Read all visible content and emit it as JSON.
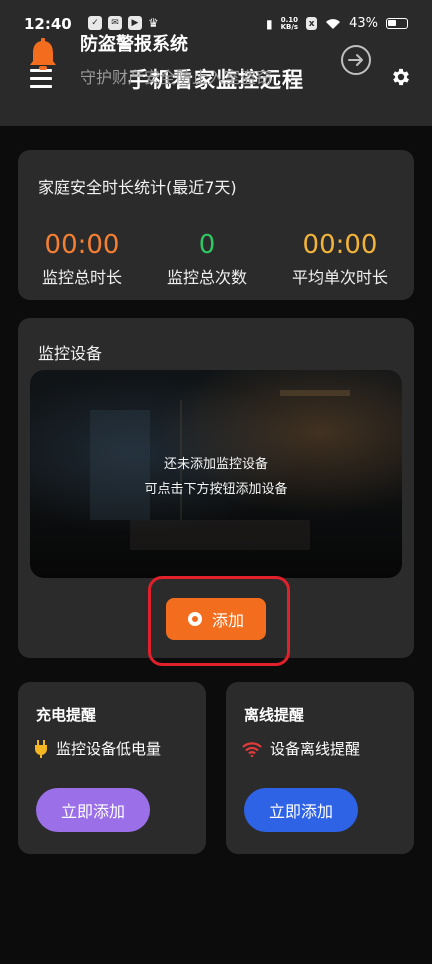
{
  "status_bar": {
    "time": "12:40",
    "speed_top": "0.10",
    "speed_bottom": "KB/s",
    "battery": "43%"
  },
  "header": {
    "title": "手机看家监控远程",
    "menu_icon": "menu-icon",
    "settings_icon": "gear-icon"
  },
  "stats": {
    "title": "家庭安全时长统计(最近7天)",
    "items": [
      {
        "value": "00:00",
        "label": "监控总时长",
        "color": "#f57f32"
      },
      {
        "value": "0",
        "label": "监控总次数",
        "color": "#2fc761"
      },
      {
        "value": "00:00",
        "label": "平均单次时长",
        "color": "#f2b33a"
      }
    ]
  },
  "devices": {
    "title": "监控设备",
    "empty_line1": "还未添加监控设备",
    "empty_line2": "可点击下方按钮添加设备",
    "add_button": "添加",
    "add_color": "#f36d1e"
  },
  "reminders": [
    {
      "title": "充电提醒",
      "desc": "监控设备低电量",
      "icon": "plug-icon",
      "button": "立即添加",
      "button_color": "#9b6fe7"
    },
    {
      "title": "离线提醒",
      "desc": "设备离线提醒",
      "icon": "wifi-icon",
      "button": "立即添加",
      "button_color": "#2f63e6"
    }
  ],
  "alarm": {
    "title": "防盗警报系统",
    "subtitle": "守护财产安全防止入室盗窃",
    "icon": "bell-icon"
  }
}
